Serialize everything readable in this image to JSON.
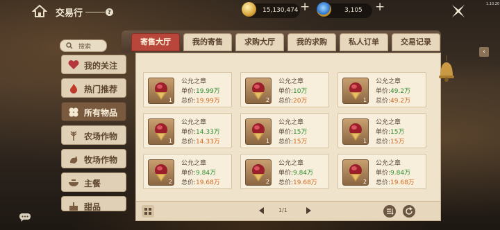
{
  "header": {
    "title": "交易行",
    "help": "?",
    "currency1": "15,130,474",
    "currency2": "3,105",
    "plus": "+",
    "version": "1.10.20"
  },
  "sidebar": {
    "search_label": "搜索",
    "items": [
      {
        "label": "我的关注",
        "icon": "heart-icon"
      },
      {
        "label": "热门推荐",
        "icon": "flame-icon"
      },
      {
        "label": "所有物品",
        "icon": "clover-icon",
        "active": true
      },
      {
        "label": "农场作物",
        "icon": "wheat-icon"
      },
      {
        "label": "牧场作物",
        "icon": "rooster-icon"
      },
      {
        "label": "主餐",
        "icon": "bowl-icon"
      },
      {
        "label": "甜品",
        "icon": "cake-icon"
      }
    ]
  },
  "tabs": [
    "寄售大厅",
    "我的寄售",
    "求购大厅",
    "我的求购",
    "私人订单",
    "交易记录"
  ],
  "listing_labels": {
    "unit": "单价:",
    "total": "总价:"
  },
  "items": [
    {
      "name": "公允之章",
      "qty": "1",
      "unit": "19.99万",
      "total": "19.99万"
    },
    {
      "name": "公允之章",
      "qty": "2",
      "unit": "10万",
      "total": "20万"
    },
    {
      "name": "公允之章",
      "qty": "1",
      "unit": "49.2万",
      "total": "49.2万"
    },
    {
      "name": "公允之章",
      "qty": "1",
      "unit": "14.33万",
      "total": "14.33万"
    },
    {
      "name": "公允之章",
      "qty": "1",
      "unit": "15万",
      "total": "15万"
    },
    {
      "name": "公允之章",
      "qty": "1",
      "unit": "15万",
      "total": "15万"
    },
    {
      "name": "公允之章",
      "qty": "2",
      "unit": "9.84万",
      "total": "19.68万"
    },
    {
      "name": "公允之章",
      "qty": "2",
      "unit": "9.84万",
      "total": "19.68万"
    },
    {
      "name": "公允之章",
      "qty": "2",
      "unit": "9.84万",
      "total": "19.68万"
    }
  ],
  "pagination": {
    "text": "1/1"
  },
  "colors": {
    "unit_price": "#2f8f2f",
    "total_price": "#d2691e",
    "active_tab": "#b8463a"
  }
}
